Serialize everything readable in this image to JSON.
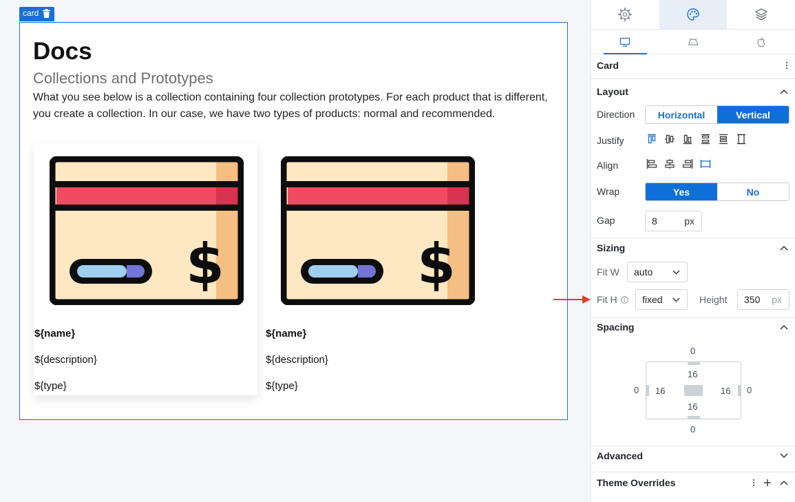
{
  "canvas": {
    "selection_tag": "card",
    "title": "Docs",
    "subtitle": "Collections and Prototypes",
    "body": "What you see below is a collection containing four collection prototypes. For each product that is different, you create a collection. In our case, we have two types of products: normal and recommended.",
    "prototypes": [
      {
        "name": "${name}",
        "description": "${description}",
        "type": "${type}"
      },
      {
        "name": "${name}",
        "description": "${description}",
        "type": "${type}"
      }
    ]
  },
  "panel": {
    "top_tabs": [
      "gear-icon",
      "palette-icon",
      "layers-icon"
    ],
    "device_tabs": [
      "desktop-icon",
      "android-icon",
      "apple-icon"
    ],
    "component_name": "Card",
    "layout": {
      "title": "Layout",
      "direction_label": "Direction",
      "direction_options": [
        "Horizontal",
        "Vertical"
      ],
      "direction_selected": "Vertical",
      "justify_label": "Justify",
      "align_label": "Align",
      "wrap_label": "Wrap",
      "wrap_options": [
        "Yes",
        "No"
      ],
      "wrap_selected": "Yes",
      "gap_label": "Gap",
      "gap_value": "8",
      "gap_unit": "px"
    },
    "sizing": {
      "title": "Sizing",
      "fit_w_label": "Fit W",
      "fit_w_value": "auto",
      "fit_h_label": "Fit H",
      "fit_h_value": "fixed",
      "height_label": "Height",
      "height_value": "350",
      "height_unit": "px"
    },
    "spacing": {
      "title": "Spacing",
      "margin_top": "0",
      "margin_left": "0",
      "margin_right": "0",
      "margin_bottom": "0",
      "padding_top": "16",
      "padding_left": "16",
      "padding_right": "16",
      "padding_bottom": "16"
    },
    "advanced_title": "Advanced",
    "theme_overrides_title": "Theme Overrides"
  },
  "colors": {
    "accent": "#0f6fd8",
    "selection": "#1a6fd4",
    "arrow": "#e53b2c",
    "card_outline": "#0d0d0d",
    "card_body": "#fde8c3",
    "card_stripe": "#f04b63",
    "card_shade": "#f5be83"
  }
}
